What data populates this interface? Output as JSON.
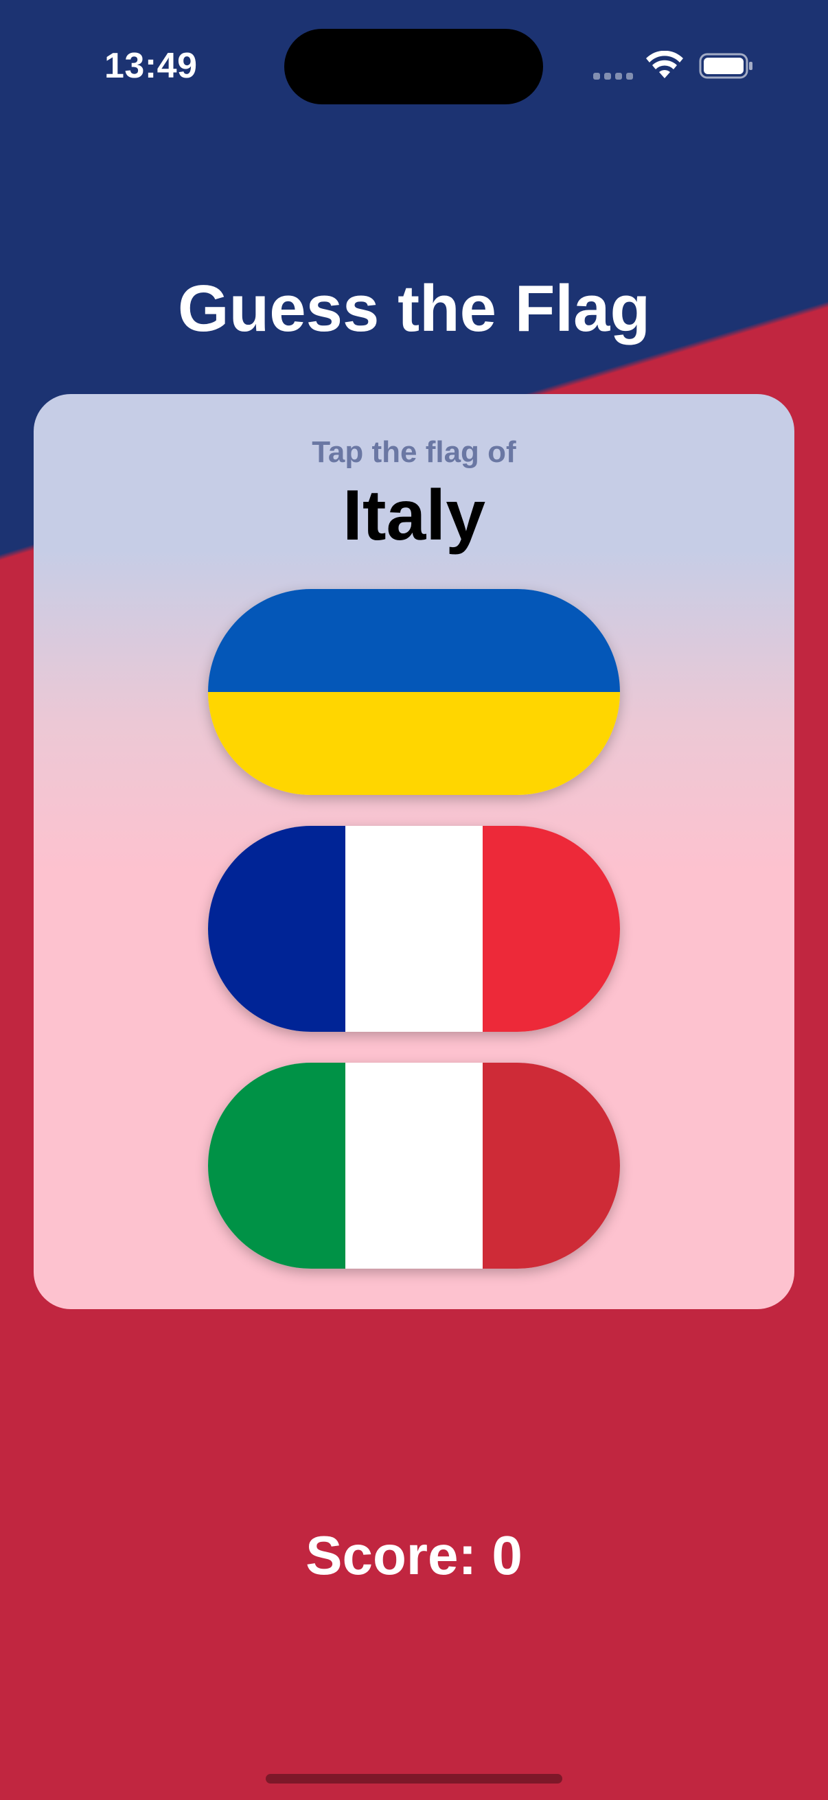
{
  "status_bar": {
    "time": "13:49"
  },
  "app": {
    "title": "Guess the Flag"
  },
  "question": {
    "prompt": "Tap the flag of",
    "country": "Italy"
  },
  "flags": [
    {
      "icon": "ukraine-flag",
      "orientation": "horizontal",
      "colors": [
        "#0457b8",
        "#ffd600"
      ]
    },
    {
      "icon": "france-flag",
      "orientation": "vertical",
      "colors": [
        "#002496",
        "#ffffff",
        "#ed2939"
      ]
    },
    {
      "icon": "italy-flag",
      "orientation": "vertical",
      "colors": [
        "#009246",
        "#ffffff",
        "#ce2b37"
      ]
    }
  ],
  "score": {
    "text": "Score: 0"
  },
  "colors": {
    "top_background": "#1c3372",
    "bottom_background": "#c12640"
  }
}
